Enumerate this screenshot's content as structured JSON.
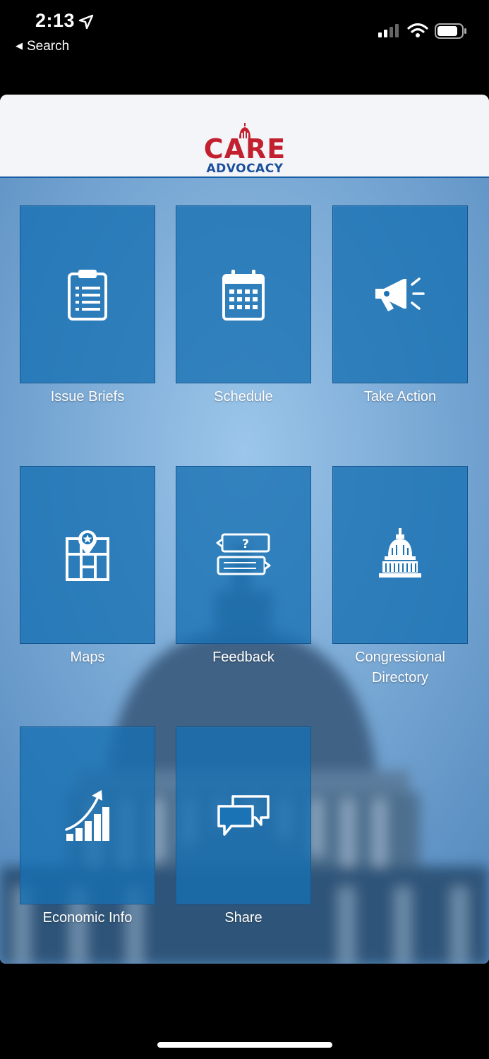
{
  "status_bar": {
    "time": "2:13",
    "back_label": "Search"
  },
  "header": {
    "logo_top": "CARE",
    "logo_bottom": "ADVOCACY",
    "logo_colors": {
      "care": "#c3202f",
      "advocacy": "#1c4f9c"
    }
  },
  "tiles": [
    {
      "label": "Issue Briefs",
      "icon": "clipboard-list-icon"
    },
    {
      "label": "Schedule",
      "icon": "calendar-icon"
    },
    {
      "label": "Take Action",
      "icon": "megaphone-icon"
    },
    {
      "label": "Maps",
      "icon": "map-pin-icon"
    },
    {
      "label": "Feedback",
      "icon": "chat-question-icon"
    },
    {
      "label": "Congressional Directory",
      "icon": "capitol-dome-icon"
    },
    {
      "label": "Economic Info",
      "icon": "growth-chart-icon"
    },
    {
      "label": "Share",
      "icon": "share-chat-icon"
    }
  ],
  "colors": {
    "tile": "#1670b2",
    "header_rule": "#1a5fa6"
  }
}
